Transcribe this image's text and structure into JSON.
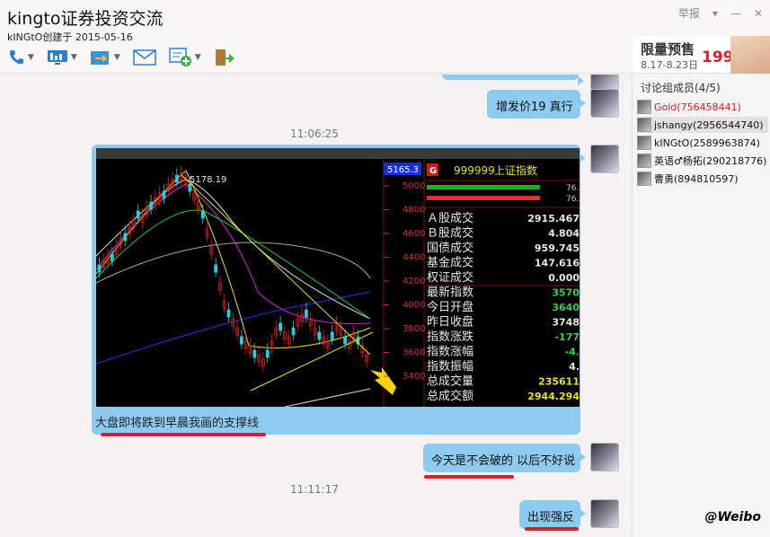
{
  "window": {
    "title": "kingto证券投资交流",
    "subtitle": "kINGtO创建于 2015-05-16",
    "report_label": "举报"
  },
  "toolbar": {
    "items": [
      {
        "icon": "phone-icon"
      },
      {
        "icon": "screen-share-icon"
      },
      {
        "icon": "file-transfer-icon"
      },
      {
        "icon": "mail-icon"
      },
      {
        "icon": "add-app-icon"
      },
      {
        "icon": "exit-group-icon"
      }
    ]
  },
  "chat": {
    "messages": [
      {
        "id": "m1",
        "text": "增发价19  真行",
        "side": "right"
      },
      {
        "id": "t1",
        "timestamp": "11:06:25"
      },
      {
        "id": "m2",
        "caption": "大盘即将跌到早晨我画的支撑线",
        "side": "right"
      },
      {
        "id": "m3",
        "text": "今天是不会破的 以后不好说",
        "side": "right"
      },
      {
        "id": "t2",
        "timestamp": "11:11:17"
      },
      {
        "id": "m4",
        "text": "出现强反",
        "side": "right"
      }
    ]
  },
  "stock_panel": {
    "index_code": "999999",
    "index_name": "上证指数",
    "top_value": "5165.3",
    "peak_label": "5178.19",
    "g_badge": "G",
    "y_ticks": [
      "5000",
      "4800",
      "4600",
      "4400",
      "4200",
      "4000",
      "3800",
      "3600",
      "3400"
    ],
    "rows": [
      {
        "label": "Ａ股成交",
        "value": "2915.467",
        "color": "#e8e8e8"
      },
      {
        "label": "Ｂ股成交",
        "value": "4.804",
        "color": "#e8e8e8"
      },
      {
        "label": "国债成交",
        "value": "959.745",
        "color": "#e8e8e8"
      },
      {
        "label": "基金成交",
        "value": "147.616",
        "color": "#e8e8e8"
      },
      {
        "label": "权证成交",
        "value": "0.000",
        "color": "#e8e8e8"
      },
      {
        "label": "最新指数",
        "value": "3570",
        "color": "#2ed24a"
      },
      {
        "label": "今日开盘",
        "value": "3640",
        "color": "#2ed24a"
      },
      {
        "label": "昨日收盘",
        "value": "3748",
        "color": "#e8e8e8"
      },
      {
        "label": "指数涨跌",
        "value": "-177",
        "color": "#2ed24a"
      },
      {
        "label": "指数涨幅",
        "value": "-4.",
        "color": "#2ed24a"
      },
      {
        "label": "指数振幅",
        "value": "4.",
        "color": "#e8e8e8"
      },
      {
        "label": "总成交量",
        "value": "235611",
        "color": "#e6e020"
      },
      {
        "label": "总成交额",
        "value": "2944.294",
        "color": "#e6e020"
      }
    ],
    "bar_values": [
      "76.",
      "76."
    ]
  },
  "sidebar": {
    "ad": {
      "title": "限量预售",
      "date": "8.17-8.23日",
      "price": "199"
    },
    "members_title": "讨论组成员(4/5)",
    "members": [
      {
        "name": "Gold(756458441)",
        "color": "#e01a2a"
      },
      {
        "name": "jshangy(2956544740)",
        "color": "#111"
      },
      {
        "name": "kINGtO(2589963874)",
        "color": "#111"
      },
      {
        "name": "英语♂杨拓(290218776)",
        "color": "#111"
      },
      {
        "name": "曹勇(894810597)",
        "color": "#111"
      }
    ],
    "watermark": "@Weibo"
  }
}
